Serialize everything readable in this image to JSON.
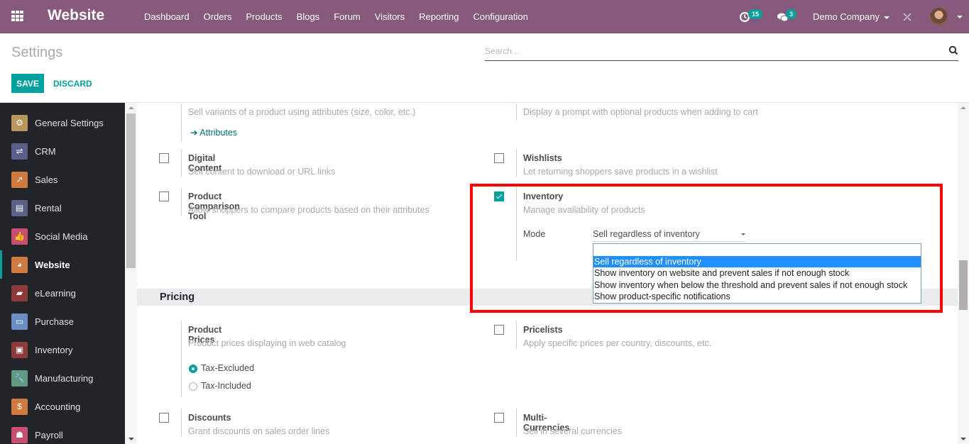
{
  "navbar": {
    "app_name": "Website",
    "menu": [
      "Dashboard",
      "Orders",
      "Products",
      "Blogs",
      "Forum",
      "Visitors",
      "Reporting",
      "Configuration"
    ],
    "activity_count": "15",
    "messages_count": "3",
    "company": "Demo Company",
    "accent_color": "#875a7b"
  },
  "control_panel": {
    "title": "Settings",
    "search_placeholder": "Search...",
    "search_value": "",
    "save_label": "SAVE",
    "discard_label": "DISCARD"
  },
  "sidebar": {
    "items": [
      {
        "label": "General Settings",
        "icon": "gear-icon",
        "color": "#b9965b"
      },
      {
        "label": "CRM",
        "icon": "handshake-icon",
        "color": "#5a5f8c"
      },
      {
        "label": "Sales",
        "icon": "chart-icon",
        "color": "#d07a3f"
      },
      {
        "label": "Rental",
        "icon": "calendar-icon",
        "color": "#5b6187"
      },
      {
        "label": "Social Media",
        "icon": "thumbs-up-icon",
        "color": "#c74f6f"
      },
      {
        "label": "Website",
        "icon": "globe-icon",
        "color": "#d07a3f",
        "active": true
      },
      {
        "label": "eLearning",
        "icon": "elearning-icon",
        "color": "#8e3a3a"
      },
      {
        "label": "Purchase",
        "icon": "credit-card-icon",
        "color": "#6b8fc2"
      },
      {
        "label": "Inventory",
        "icon": "box-icon",
        "color": "#8e3a3a"
      },
      {
        "label": "Manufacturing",
        "icon": "wrench-icon",
        "color": "#5f9b82"
      },
      {
        "label": "Accounting",
        "icon": "invoice-icon",
        "color": "#d07a3f"
      },
      {
        "label": "Payroll",
        "icon": "payroll-icon",
        "color": "#c74f6f"
      }
    ]
  },
  "settings": {
    "variants_desc": "Sell variants of a product using attributes (size, color, etc.)",
    "attributes_link": "Attributes",
    "optional_desc": "Display a prompt with optional products when adding to cart",
    "digital_content": {
      "title": "Digital Content",
      "desc": "Sell content to download or URL links",
      "checked": false
    },
    "wishlists": {
      "title": "Wishlists",
      "desc": "Let returning shoppers save products in a wishlist",
      "checked": false
    },
    "comparison": {
      "title": "Product Comparison Tool",
      "desc": "Allow shoppers to compare products based on their attributes",
      "checked": false
    },
    "inventory": {
      "title": "Inventory",
      "desc": "Manage availability of products",
      "checked": true,
      "mode_label": "Mode",
      "mode_value": "Sell regardless of inventory",
      "mode_options": [
        "Sell regardless of inventory",
        "Show inventory on website and prevent sales if not enough stock",
        "Show inventory when below the threshold and prevent sales if not enough stock",
        "Show product-specific notifications"
      ],
      "selected_index": 0
    },
    "pricing_section": "Pricing",
    "product_prices": {
      "title": "Product Prices",
      "desc": "Product prices displaying in web catalog",
      "options": [
        "Tax-Excluded",
        "Tax-Included"
      ],
      "selected": "Tax-Excluded"
    },
    "pricelists": {
      "title": "Pricelists",
      "desc": "Apply specific prices per country, discounts, etc.",
      "checked": false
    },
    "discounts": {
      "title": "Discounts",
      "desc": "Grant discounts on sales order lines",
      "checked": false
    },
    "multi_currencies": {
      "title": "Multi-Currencies",
      "desc": "Sell in several currencies",
      "checked": false
    }
  }
}
